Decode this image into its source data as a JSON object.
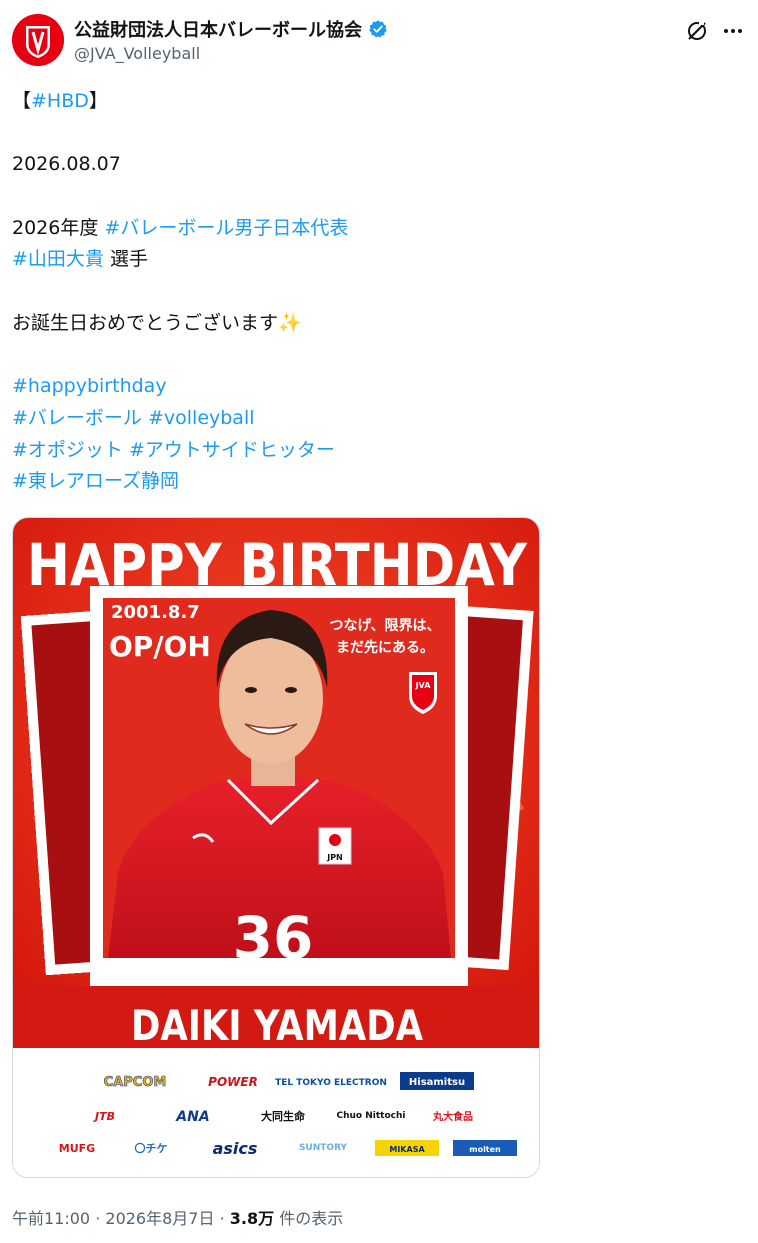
{
  "header": {
    "author_name": "公益財団法人日本バレーボール協会",
    "handle": "@JVA_Volleyball",
    "avatar_text": "JVA",
    "verified_icon": "verified-badge-icon",
    "grok_icon": "grok-icon",
    "more_icon": "more-icon"
  },
  "tweet": {
    "line1_prefix": "【",
    "line1_tag": "#HBD",
    "line1_suffix": "】",
    "date": "2026.08.07",
    "line3_prefix": "2026年度 ",
    "line3_tag": "#バレーボール男子日本代表",
    "line4_tag": "#山田大貴",
    "line4_suffix": " 選手",
    "line5": "お誕生日おめでとうございます",
    "line5_emoji": "✨",
    "tag_happy": "#happybirthday",
    "tag_volley_jp": "#バレーボール",
    "tag_volley_en": "#volleyball",
    "tag_opposite": "#オポジット",
    "tag_outside": "#アウトサイドヒッター",
    "tag_team": "#東レアローズ静岡"
  },
  "media": {
    "headline": "HAPPY BIRTHDAY",
    "birthdate": "2001.8.7",
    "position": "OP/OH",
    "slogan_line1": "つなげ、限界は、",
    "slogan_line2": "まだ先にある。",
    "jersey_number": "36",
    "jersey_country": "JPN",
    "logo_text": "JVA",
    "player_name": "DAIKI YAMADA",
    "sponsors_row1": [
      "CAPCOM",
      "POWER",
      "TEL TOKYO ELECTRON",
      "Hisamitsu"
    ],
    "sponsors_row2": [
      "JTB",
      "ANA",
      "大同生命",
      "Chuo Nittochi",
      "丸大食品"
    ],
    "sponsors_row3": [
      "MUFG",
      "〇チケ",
      "asics",
      "SUNTORY",
      "MIKASA",
      "molten"
    ]
  },
  "footer": {
    "time": "午前11:00",
    "sep1": " · ",
    "date": "2026年8月7日",
    "sep2": " · ",
    "views": "3.8万",
    "views_label": " 件の表示"
  },
  "colors": {
    "link": "#1d9bf0",
    "brand_red": "#e60012",
    "text": "#0f1419",
    "muted": "#536471"
  }
}
